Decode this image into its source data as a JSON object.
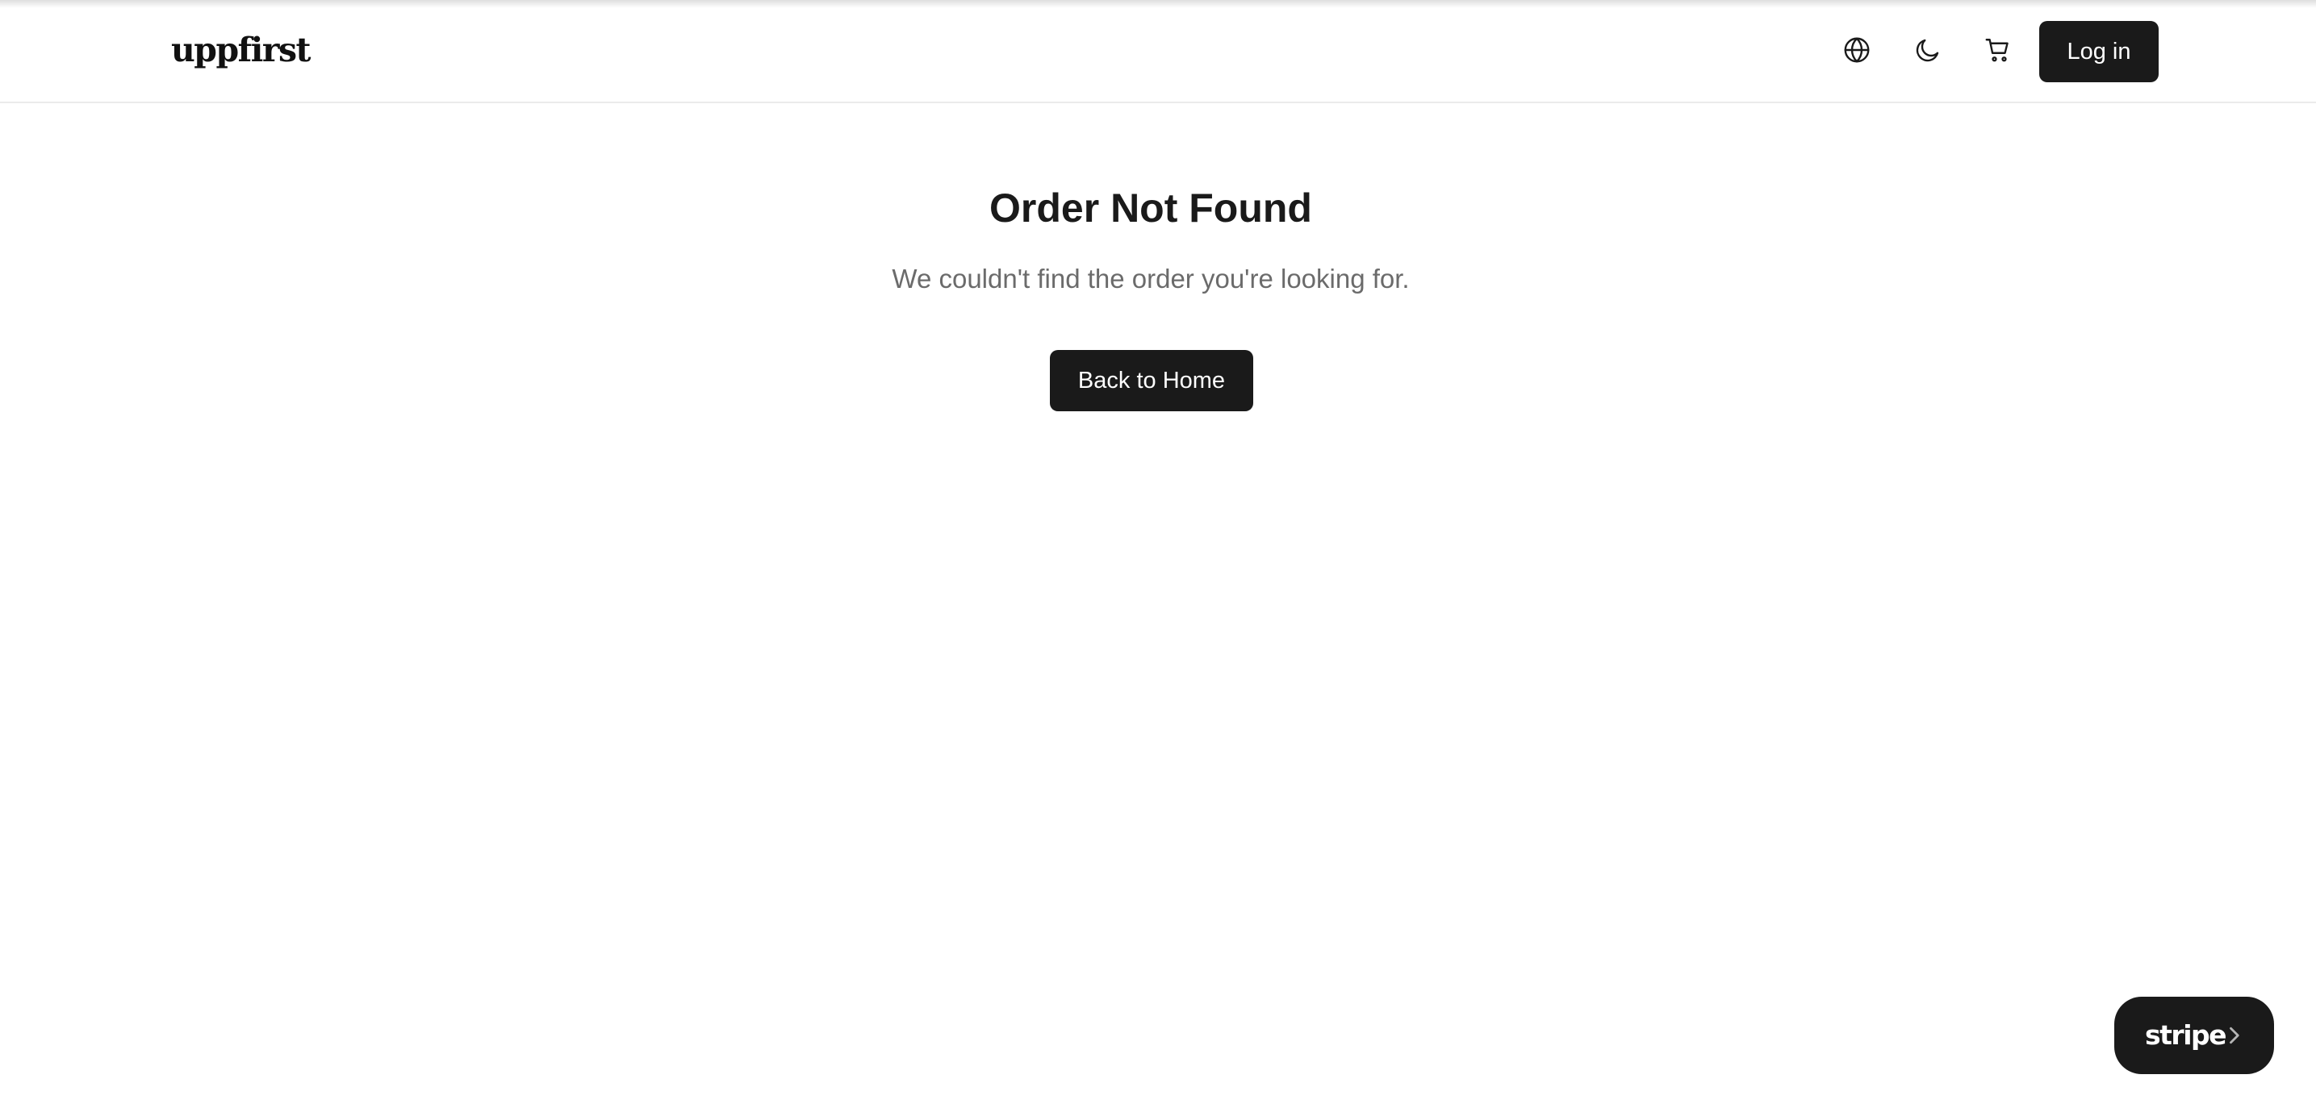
{
  "header": {
    "logo_text": "uppfirst",
    "icons": {
      "language": "globe-icon",
      "theme": "moon-icon",
      "cart": "cart-icon"
    },
    "login_label": "Log in"
  },
  "main": {
    "title": "Order Not Found",
    "message": "We couldn't find the order you're looking for.",
    "home_button_label": "Back to Home"
  },
  "stripe_badge": {
    "label": "stripe",
    "icon": "chevron-right-icon"
  },
  "colors": {
    "button_bg": "#1a1a1a",
    "button_text": "#ffffff",
    "title_text": "#1a1a1a",
    "muted_text": "#6b6b6b",
    "divider": "#ebebeb",
    "page_bg": "#ffffff"
  }
}
